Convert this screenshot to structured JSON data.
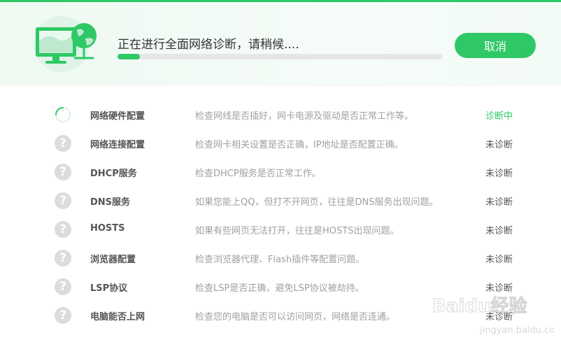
{
  "header": {
    "status_text": "正在进行全面网络诊断，请稍候....",
    "progress": 0.07,
    "cancel_label": "取消"
  },
  "colors": {
    "accent": "#2ec866",
    "icon_gray": "#dcdcdc"
  },
  "icons": {
    "hero": "network-computer-globe-icon",
    "running": "spinner-icon",
    "pending": "question-icon"
  },
  "checks": [
    {
      "name": "网络硬件配置",
      "desc": "检查网线是否插好，网卡电源及驱动是否正常工作等。",
      "state": "诊断中"
    },
    {
      "name": "网络连接配置",
      "desc": "检查网卡相关设置是否正确，IP地址是否配置正确。",
      "state": "未诊断"
    },
    {
      "name": "DHCP服务",
      "desc": "检查DHCP服务是否正常工作。",
      "state": "未诊断"
    },
    {
      "name": "DNS服务",
      "desc": "如果您能上QQ，但打不开网页，往往是DNS服务出现问题。",
      "state": "未诊断"
    },
    {
      "name": "HOSTS",
      "desc": "如果有些网页无法打开，往往是HOSTS出现问题。",
      "state": "未诊断"
    },
    {
      "name": "浏览器配置",
      "desc": "检查浏览器代理、Flash插件等配置问题。",
      "state": "未诊断"
    },
    {
      "name": "LSP协议",
      "desc": "检查LSP是否正确，避免LSP协议被劫持。",
      "state": "未诊断"
    },
    {
      "name": "电脑能否上网",
      "desc": "检查您的电脑是否可以访问网页，网络是否连通。",
      "state": "未诊断"
    }
  ],
  "watermark": {
    "brand": "Baidu经验",
    "url": "jingyan.baidu.com"
  }
}
